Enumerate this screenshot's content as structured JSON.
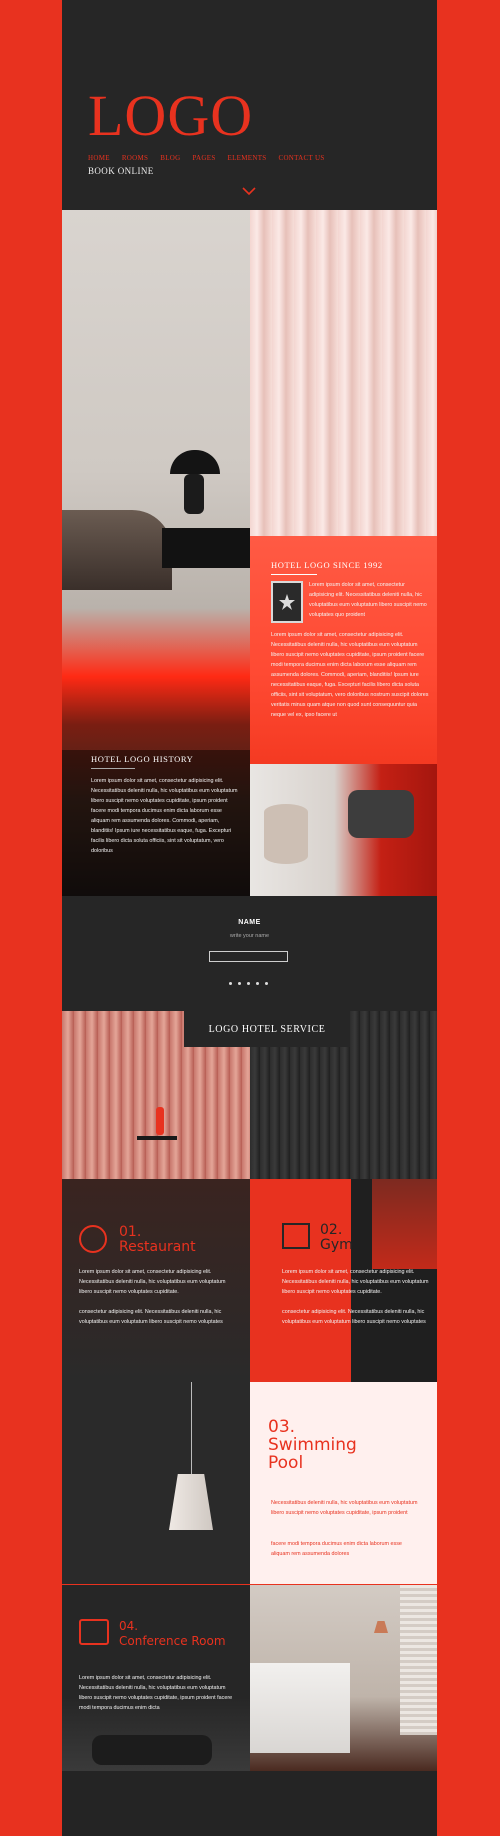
{
  "brand": {
    "logo": "LOGO",
    "accent": "#e8321f",
    "dark": "#242424"
  },
  "nav": {
    "items": [
      "HOME",
      "ROOMS",
      "BLOG",
      "PAGES",
      "ELEMENTS",
      "CONTACT US"
    ],
    "book": "BOOK ONLINE"
  },
  "since": {
    "title": "HOTEL LOGO SINCE 1992",
    "text_short": "Lorem ipsum dolor sit amet, consectetur adipisicing elit. Necessitatibus deleniti nulla, hic voluptatibus eum voluptatum libero suscipit nemo voluptates quo proident",
    "text_long": "Lorem ipsum dolor sit amet, consectetur adipisicing elit. Necessitatibus deleniti nulla, hic voluptatibus eum voluptatum libero suscipit nemo voluptates cupiditate, ipsum proident facere modi tempora ducimus enim dicta laborum esse aliquam rem assumenda dolores. Commodi, aperiam, blanditiis! Ipsum iure necessitatibus eaque, fuga. Excepturi facilis libero dicta soluta officiis, sint sit voluptatum, vero doloribus nostrum suscipit dolores veritatis minus quam atque non quod sunt consequuntur quia neque vel ex, ipso facere ut"
  },
  "history": {
    "title": "HOTEL LOGO HISTORY",
    "text": "Lorem ipsum dolor sit amet, consectetur adipisicing elit. Necessitatibus deleniti nulla, hic voluptatibus eum voluptatum libero suscipit nemo voluptates cupiditate, ipsum proident facere modi tempora ducimus enim dicta laborum esse aliquam rem assumenda dolores. Commodi, aperiam, blanditiis! Ipsum iure necessitatibus eaque, fuga. Excepturi facilis libero dicta soluta officiis, sint sit voluptatum, vero doloribus"
  },
  "form": {
    "name_label": "NAME",
    "name_placeholder": "write your name"
  },
  "service": {
    "title": "LOGO HOTEL SERVICE"
  },
  "services": [
    {
      "num": "01.",
      "name": "Restaurant",
      "p1": "Lorem ipsum dolor sit amet, consectetur adipisicing elit. Necessitatibus deleniti nulla, hic voluptatibus eum voluptatum libero suscipit nemo voluptates cupiditate.",
      "p2": "consectetur adipisicing elit. Necessitatibus deleniti nulla, hic voluptatibus eum voluptatum libero suscipit nemo voluptates"
    },
    {
      "num": "02.",
      "name": "Gym",
      "p1": "Lorem ipsum dolor sit amet, consectetur adipisicing elit. Necessitatibus deleniti nulla, hic voluptatibus eum voluptatum libero suscipit nemo voluptates cupiditate.",
      "p2": "consectetur adipisicing elit. Necessitatibus deleniti nulla, hic voluptatibus eum voluptatum libero suscipit nemo voluptates"
    },
    {
      "num": "03.",
      "name1": "Swimming",
      "name2": "Pool",
      "p1": "Necessitatibus deleniti nulla, hic voluptatibus eum voluptatum libero suscipit nemo voluptates cupiditate, ipsum proident",
      "p2": "facere modi tempora ducimus enim dicta laborum esse aliquam rem assumenda dolores"
    },
    {
      "num": "04.",
      "name": "Conference Room",
      "p1": "Lorem ipsum dolor sit amet, consectetur adipisicing elit. Necessitatibus deleniti nulla, hic voluptatibus eum voluptatum libero suscipit nemo voluptates cupiditate, ipsum proident facere modi tempora ducimus enim dicta"
    }
  ],
  "icons": {
    "chevron": "chevron-down-icon",
    "award": "award-frame-icon",
    "restaurant": "cutlery-icon",
    "gym": "gym-icon",
    "conference": "conference-icon"
  }
}
